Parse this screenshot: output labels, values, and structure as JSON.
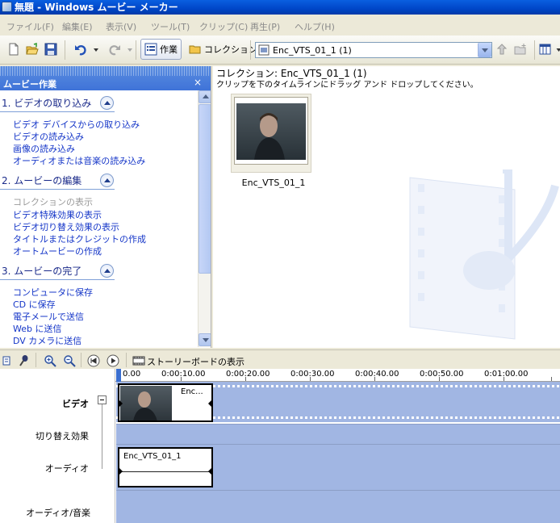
{
  "window": {
    "title": "無題 - Windows ムービー メーカー",
    "icon": "movie-maker-app-icon"
  },
  "menu": [
    {
      "label": "ファイル(F)"
    },
    {
      "label": "編集(E)"
    },
    {
      "label": "表示(V)"
    },
    {
      "label": "ツール(T)"
    },
    {
      "label": "クリップ(C)"
    },
    {
      "label": "再生(P)"
    },
    {
      "label": "ヘルプ(H)"
    }
  ],
  "toolbar": {
    "tasks_label": "作業",
    "collections_label": "コレクション",
    "collection_combo": "Enc_VTS_01_1 (1)"
  },
  "taskpane": {
    "title": "ムービー作業",
    "close": "×",
    "sections": [
      {
        "title": "1. ビデオの取り込み",
        "items": [
          "ビデオ デバイスからの取り込み",
          "ビデオの読み込み",
          "画像の読み込み",
          "オーディオまたは音楽の読み込み"
        ]
      },
      {
        "title": "2. ムービーの編集",
        "items": [
          "コレクションの表示",
          "ビデオ特殊効果の表示",
          "ビデオ切り替え効果の表示",
          "タイトルまたはクレジットの作成",
          "オートムービーの作成"
        ]
      },
      {
        "title": "3. ムービーの完了",
        "items": [
          "コンピュータに保存",
          "CD に保存",
          "電子メールで送信",
          "Web に送信",
          "DV カメラに送信"
        ]
      }
    ]
  },
  "collection": {
    "title": "コレクション: Enc_VTS_01_1 (1)",
    "hint": "クリップを下のタイムラインにドラッグ アンド ドロップしてください。",
    "clip_name": "Enc_VTS_01_1"
  },
  "timeline": {
    "storyboard_label": "ストーリーボードの表示",
    "ruler_ticks": [
      "0.00",
      "0:00:10.00",
      "0:00:20.00",
      "0:00:30.00",
      "0:00:40.00",
      "0:00:50.00",
      "0:01:00.00"
    ],
    "tracks": {
      "video": "ビデオ",
      "transition": "切り替え効果",
      "audio": "オーディオ",
      "music": "オーディオ/音楽"
    },
    "video_clip_label": "Enc...",
    "audio_clip_label": "Enc_VTS_01_1"
  },
  "colors": {
    "accent": "#3f73d8",
    "track": "#a1b6e3",
    "link": "#1536c8"
  }
}
